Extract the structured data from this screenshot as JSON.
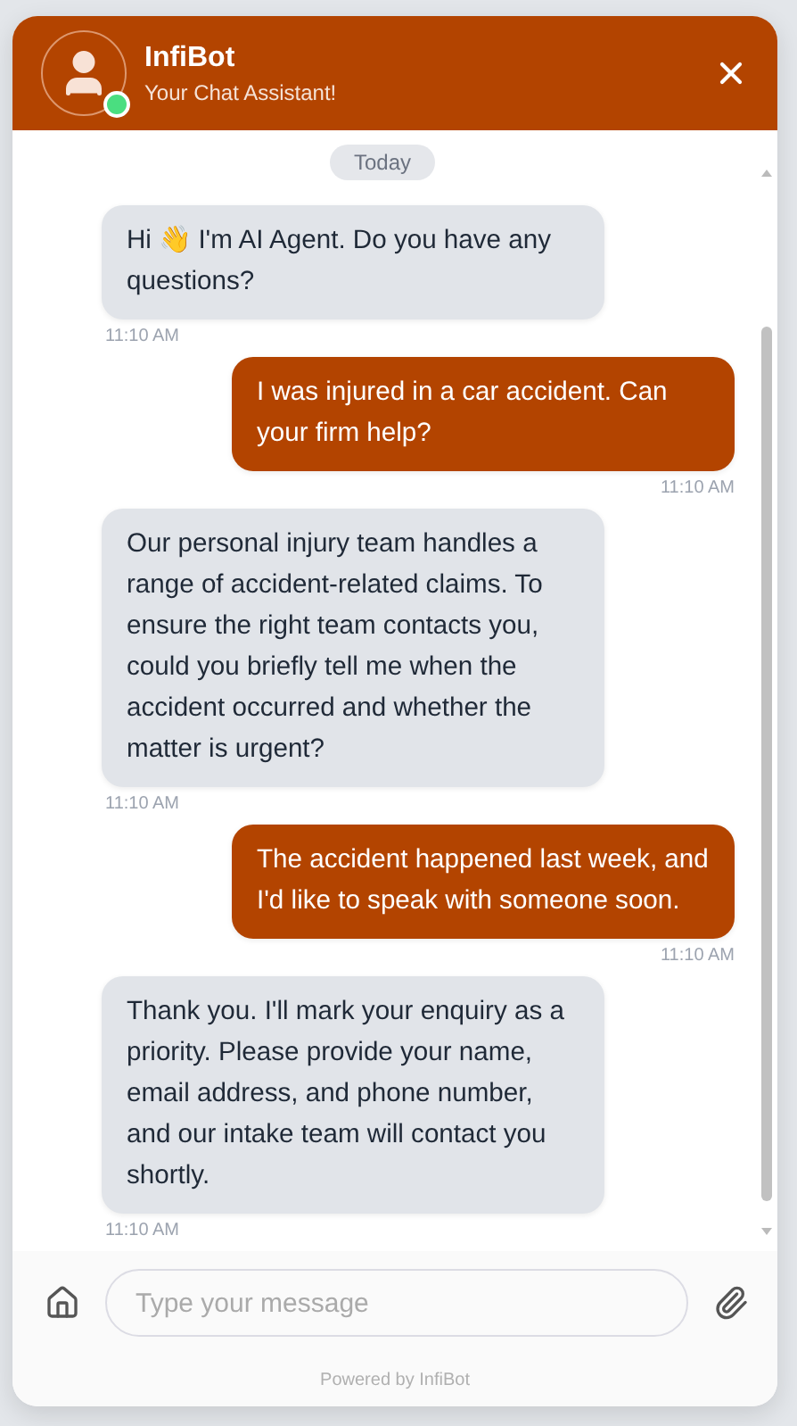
{
  "header": {
    "title": "InfiBot",
    "subtitle": "Your Chat Assistant!",
    "online": true
  },
  "date_divider": "Today",
  "messages": [
    {
      "kind": "bot",
      "text": "Hi 👋 I'm AI Agent. Do you have any questions?",
      "time": "11:10 AM"
    },
    {
      "kind": "user",
      "text": "I was injured in a car accident. Can your firm help?",
      "time": "11:10 AM"
    },
    {
      "kind": "bot",
      "text": "Our personal injury team handles a range of accident-related claims. To ensure the right team contacts you, could you briefly tell me when the accident occurred and whether the matter is urgent?",
      "time": "11:10 AM"
    },
    {
      "kind": "user",
      "text": "The accident happened last week, and I'd like to speak with someone soon.",
      "time": "11:10 AM"
    },
    {
      "kind": "bot",
      "text": "Thank you. I'll mark your enquiry as a priority. Please provide your name, email address, and phone number, and our intake team will contact you shortly.",
      "time": "11:10 AM"
    }
  ],
  "composer": {
    "placeholder": "Type your message"
  },
  "footer": "Powered by InfiBot"
}
